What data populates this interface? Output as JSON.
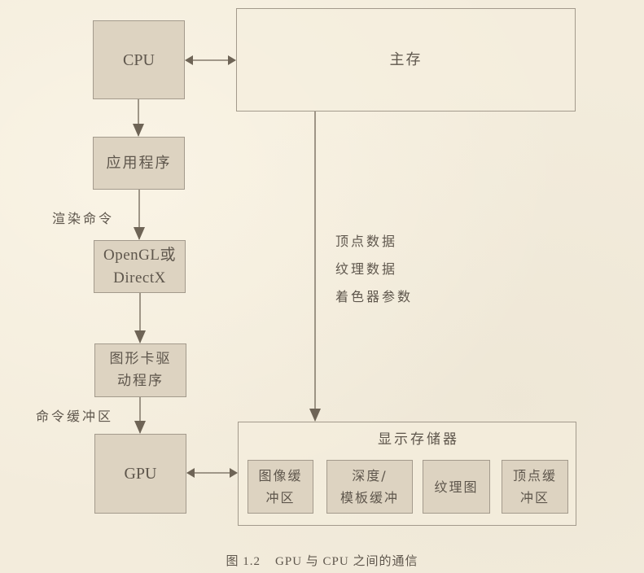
{
  "figure": {
    "caption_number": "图 1.2",
    "caption_text": "GPU 与 CPU 之间的通信"
  },
  "nodes": {
    "cpu": "CPU",
    "main_memory": "主存",
    "application": "应用程序",
    "api_line1": "OpenGL或",
    "api_line2": "DirectX",
    "driver_line1": "图形卡驱",
    "driver_line2": "动程序",
    "gpu": "GPU",
    "display_memory": "显示存储器"
  },
  "display_memory_blocks": [
    {
      "line1": "图像缓",
      "line2": "冲区"
    },
    {
      "line1": "深度/",
      "line2": "模板缓冲"
    },
    {
      "line1": "纹理图",
      "line2": ""
    },
    {
      "line1": "顶点缓",
      "line2": "冲区"
    }
  ],
  "edge_labels": {
    "render_commands": "渲染命令",
    "command_buffer": "命令缓冲区",
    "memory_transfer": [
      "顶点数据",
      "纹理数据",
      "着色器参数"
    ]
  },
  "colors": {
    "background": "#f3ecdc",
    "box_fill": "#ddd3c1",
    "box_border": "#a39a8c",
    "arrow": "#6e6456",
    "text": "#5e564c"
  }
}
